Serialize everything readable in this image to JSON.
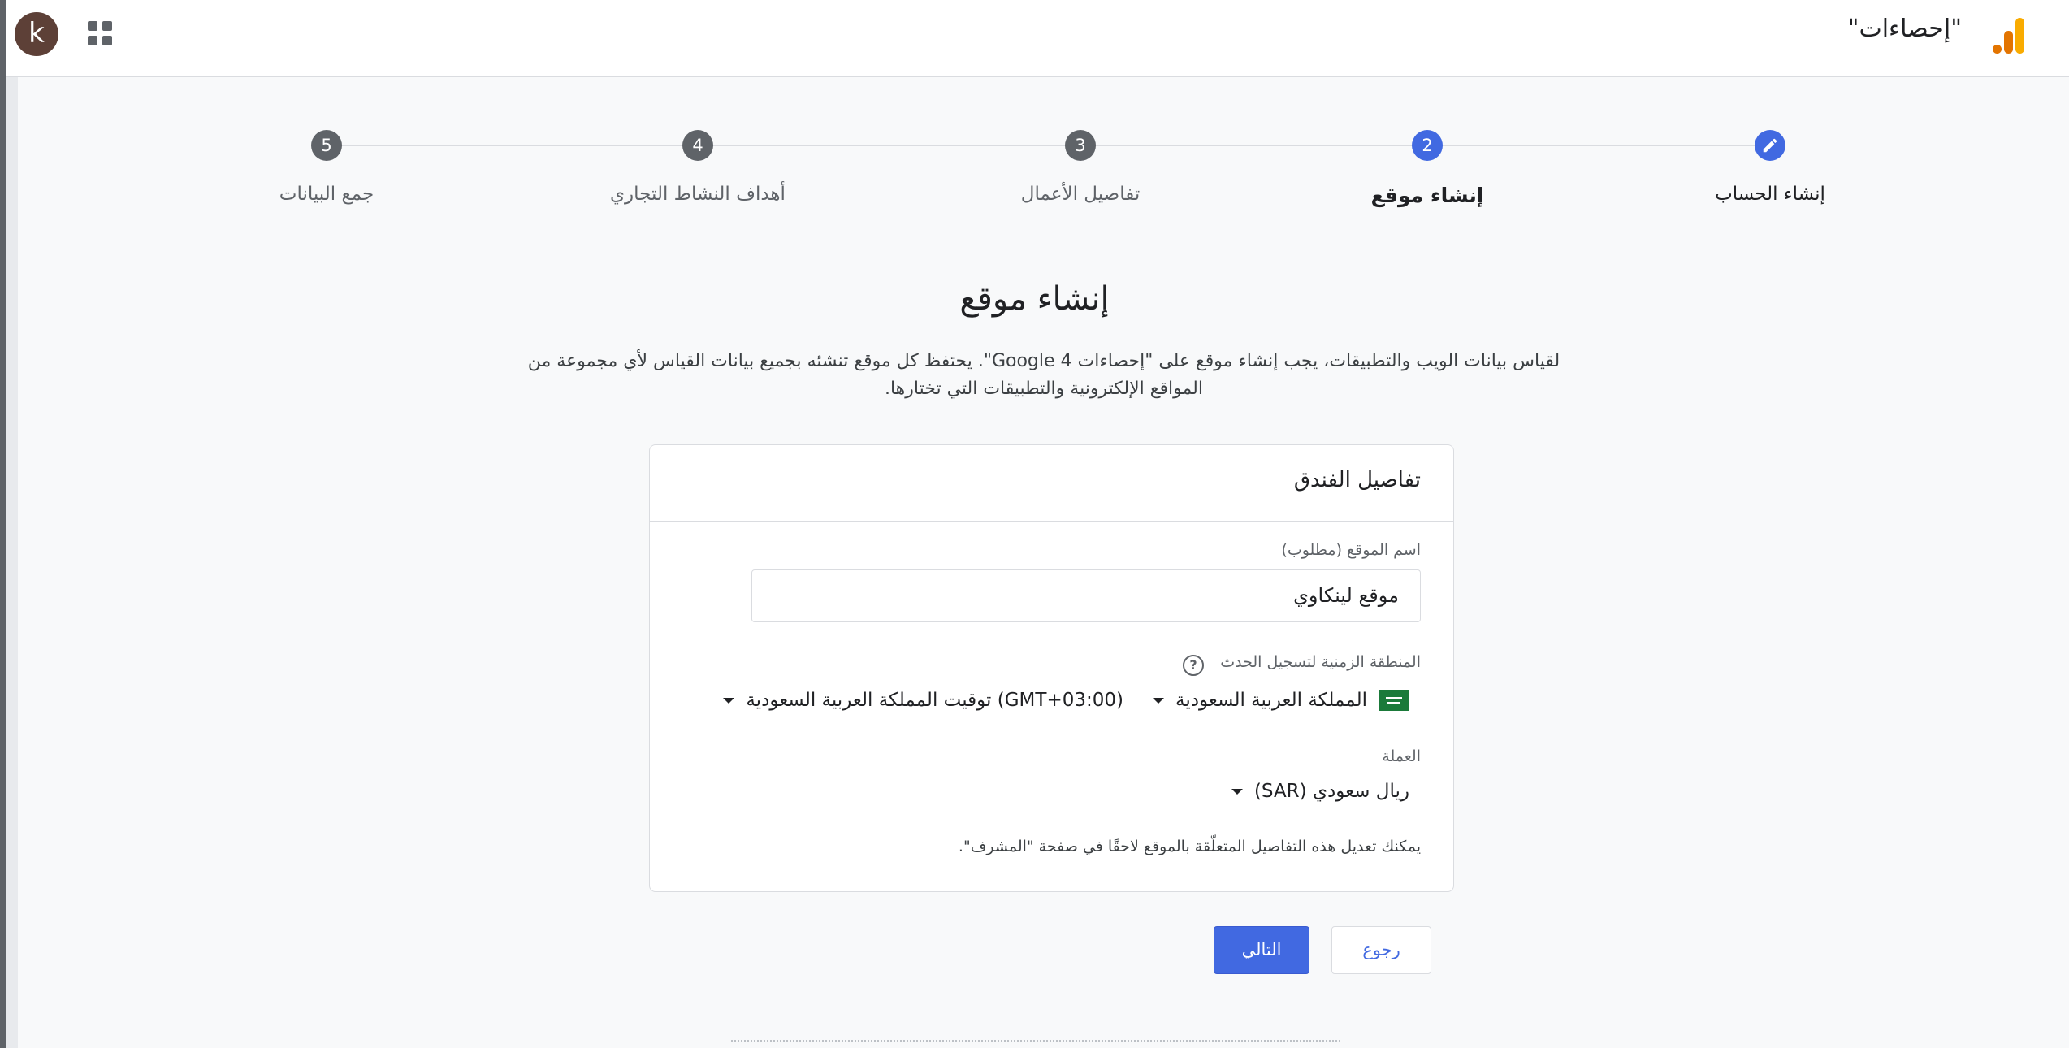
{
  "header": {
    "avatar_letter": "k",
    "product_title": "\"إحصاءات\"",
    "icons": [
      "apps-grid-icon",
      "analytics-logo"
    ]
  },
  "stepper": {
    "steps": [
      {
        "number": "",
        "label": "إنشاء الحساب",
        "state": "done",
        "icon": "edit-pencil-icon"
      },
      {
        "number": "2",
        "label": "إنشاء موقع",
        "state": "current"
      },
      {
        "number": "3",
        "label": "تفاصيل الأعمال",
        "state": "pending"
      },
      {
        "number": "4",
        "label": "أهداف النشاط التجاري",
        "state": "pending"
      },
      {
        "number": "5",
        "label": "جمع البيانات",
        "state": "pending"
      }
    ]
  },
  "main": {
    "title": "إنشاء موقع",
    "description": "لقياس بيانات الويب والتطبيقات، يجب إنشاء موقع على \"إحصاءات Google 4\". يحتفظ كل موقع تنشئه بجميع بيانات القياس لأي مجموعة من المواقع الإلكترونية والتطبيقات التي تختارها."
  },
  "card": {
    "header": "تفاصيل الفندق",
    "property_name_label": "اسم الموقع (مطلوب)",
    "property_name_value": "موقع لينكاوي",
    "timezone_label": "المنطقة الزمنية لتسجيل الحدث",
    "country_value": "المملكة العربية السعودية",
    "timezone_value": "(GMT+03:00) توقيت المملكة العربية السعودية",
    "currency_label": "العملة",
    "currency_value": "ريال سعودي (SAR)",
    "note": "يمكنك تعديل هذه التفاصيل المتعلّقة بالموقع لاحقًا في صفحة \"المشرف\"."
  },
  "actions": {
    "next_label": "التالي",
    "back_label": "رجوع"
  },
  "colors": {
    "accent": "#4169e1",
    "step_pending": "#5f6368"
  }
}
